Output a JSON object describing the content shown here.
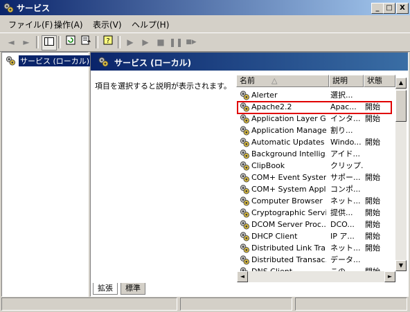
{
  "window": {
    "title": "サービス",
    "btn_min": "_",
    "btn_max": "□",
    "btn_close": "X"
  },
  "menu": [
    {
      "label": "ファイル(F)"
    },
    {
      "label": "操作(A)"
    },
    {
      "label": "表示(V)"
    },
    {
      "label": "ヘルプ(H)"
    }
  ],
  "toolbar": {
    "back": "◄",
    "forward": "►",
    "play": "▶",
    "play2": "▶",
    "stop": "■",
    "pause": "❚❚",
    "restart": "■▶"
  },
  "tree": {
    "selected_label": "サービス (ローカル)"
  },
  "panel": {
    "header": "サービス (ローカル)",
    "description": "項目を選択すると説明が表示されます。"
  },
  "list": {
    "columns": [
      "名前",
      "説明",
      "状態"
    ],
    "sort_indicator": "△",
    "rows": [
      {
        "name": "Alerter",
        "desc": "選択...",
        "status": ""
      },
      {
        "name": "Apache2.2",
        "desc": "Apac...",
        "status": "開始"
      },
      {
        "name": "Application Layer G...",
        "desc": "インタ...",
        "status": "開始"
      },
      {
        "name": "Application Manage...",
        "desc": "割り...",
        "status": ""
      },
      {
        "name": "Automatic Updates",
        "desc": "Windo...",
        "status": "開始"
      },
      {
        "name": "Background Intellig...",
        "desc": "アイド...",
        "status": ""
      },
      {
        "name": "ClipBook",
        "desc": "クリップ...",
        "status": ""
      },
      {
        "name": "COM+ Event System",
        "desc": "サポー...",
        "status": "開始"
      },
      {
        "name": "COM+ System Appl...",
        "desc": "コンポ...",
        "status": ""
      },
      {
        "name": "Computer Browser",
        "desc": "ネット...",
        "status": "開始"
      },
      {
        "name": "Cryptographic Servi...",
        "desc": "提供...",
        "status": "開始"
      },
      {
        "name": "DCOM Server Proc...",
        "desc": "DCO...",
        "status": "開始"
      },
      {
        "name": "DHCP Client",
        "desc": "IP ア...",
        "status": "開始"
      },
      {
        "name": "Distributed Link Tra...",
        "desc": "ネット...",
        "status": "開始"
      },
      {
        "name": "Distributed Transac...",
        "desc": "データ...",
        "status": ""
      },
      {
        "name": "DNS Client",
        "desc": "この...",
        "status": "開始"
      }
    ]
  },
  "tabs": [
    {
      "label": "拡張"
    },
    {
      "label": "標準"
    }
  ],
  "colors": {
    "highlight": "#e00000",
    "title_start": "#0a246a"
  }
}
